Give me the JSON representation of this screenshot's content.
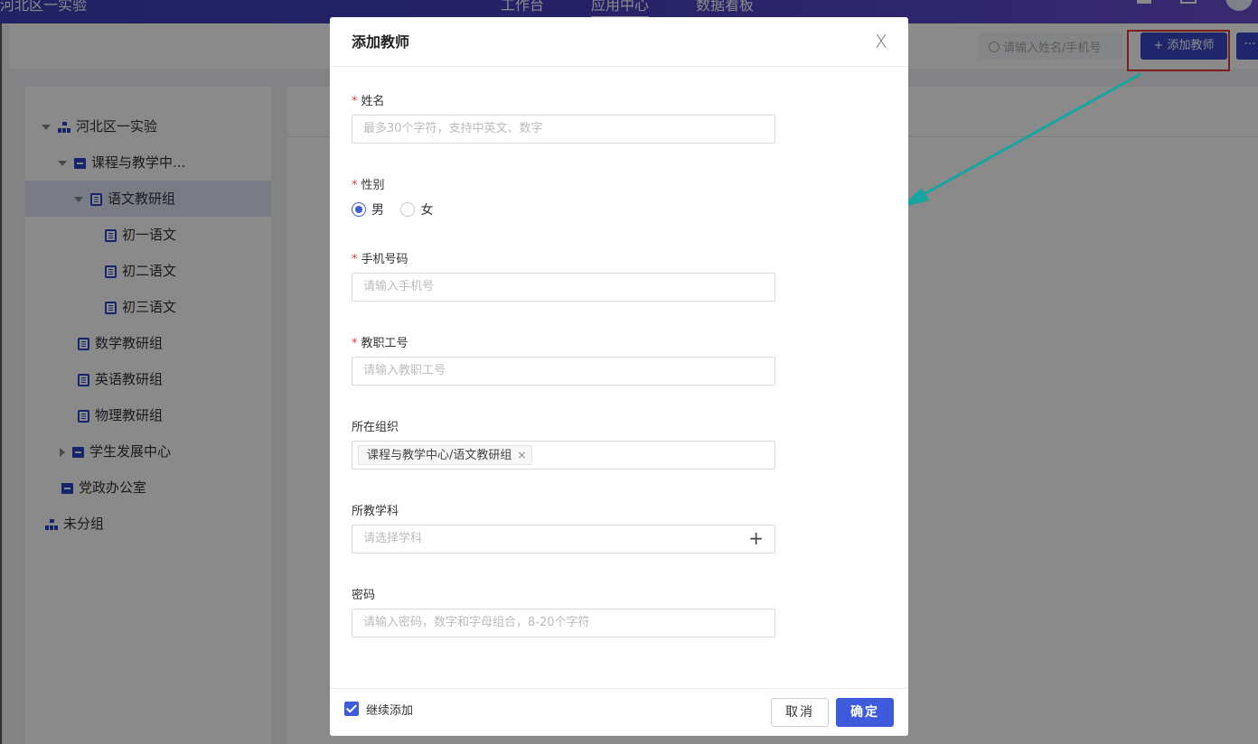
{
  "topbar": {
    "org_name": "河北区一实验",
    "nav": [
      "工作台",
      "应用中心",
      "数据看板"
    ],
    "active_nav": "应用中心"
  },
  "toolbar": {
    "search_placeholder": "请输入姓名/手机号",
    "add_button_label": "添加教师",
    "more_label": "···"
  },
  "tree": {
    "items": [
      {
        "label": "河北区一实验",
        "icon": "org-icon"
      },
      {
        "label": "课程与教学中...",
        "icon": "folder-icon"
      },
      {
        "label": "语文教研组",
        "icon": "doc-icon",
        "selected": true
      },
      {
        "label": "初一语文",
        "icon": "doc-icon"
      },
      {
        "label": "初二语文",
        "icon": "doc-icon"
      },
      {
        "label": "初三语文",
        "icon": "doc-icon"
      },
      {
        "label": "数学教研组",
        "icon": "doc-icon"
      },
      {
        "label": "英语教研组",
        "icon": "doc-icon"
      },
      {
        "label": "物理教研组",
        "icon": "doc-icon"
      },
      {
        "label": "学生发展中心",
        "icon": "folder-icon"
      },
      {
        "label": "党政办公室",
        "icon": "folder-icon"
      },
      {
        "label": "未分组",
        "icon": "org-icon"
      }
    ]
  },
  "modal": {
    "title": "添加教师",
    "close_symbol": "X",
    "fields": {
      "name": {
        "label": "姓名",
        "required": true,
        "placeholder": "最多30个字符，支持中英文、数字"
      },
      "gender": {
        "label": "性别",
        "required": true,
        "options": [
          "男",
          "女"
        ],
        "selected": "男"
      },
      "phone": {
        "label": "手机号码",
        "required": true,
        "placeholder": "请输入手机号"
      },
      "staff_id": {
        "label": "教职工号",
        "required": true,
        "placeholder": "请输入教职工号"
      },
      "org": {
        "label": "所在组织",
        "tag": "课程与教学中心/语文教研组",
        "tag_close": "×"
      },
      "subject": {
        "label": "所教学科",
        "placeholder": "请选择学科",
        "add_symbol": "+"
      },
      "password": {
        "label": "密码",
        "placeholder": "请输入密码，数字和字母组合，8-20个字符"
      }
    },
    "footer": {
      "continue_label": "继续添加",
      "continue_checked": true,
      "cancel_label": "取消",
      "confirm_label": "确定"
    },
    "required_mark": "*"
  },
  "colors": {
    "primary": "#3e5bdb",
    "topbar": "#4a40c0",
    "highlight_box": "#e53935",
    "annotation_arrow": "#16a5a0"
  }
}
